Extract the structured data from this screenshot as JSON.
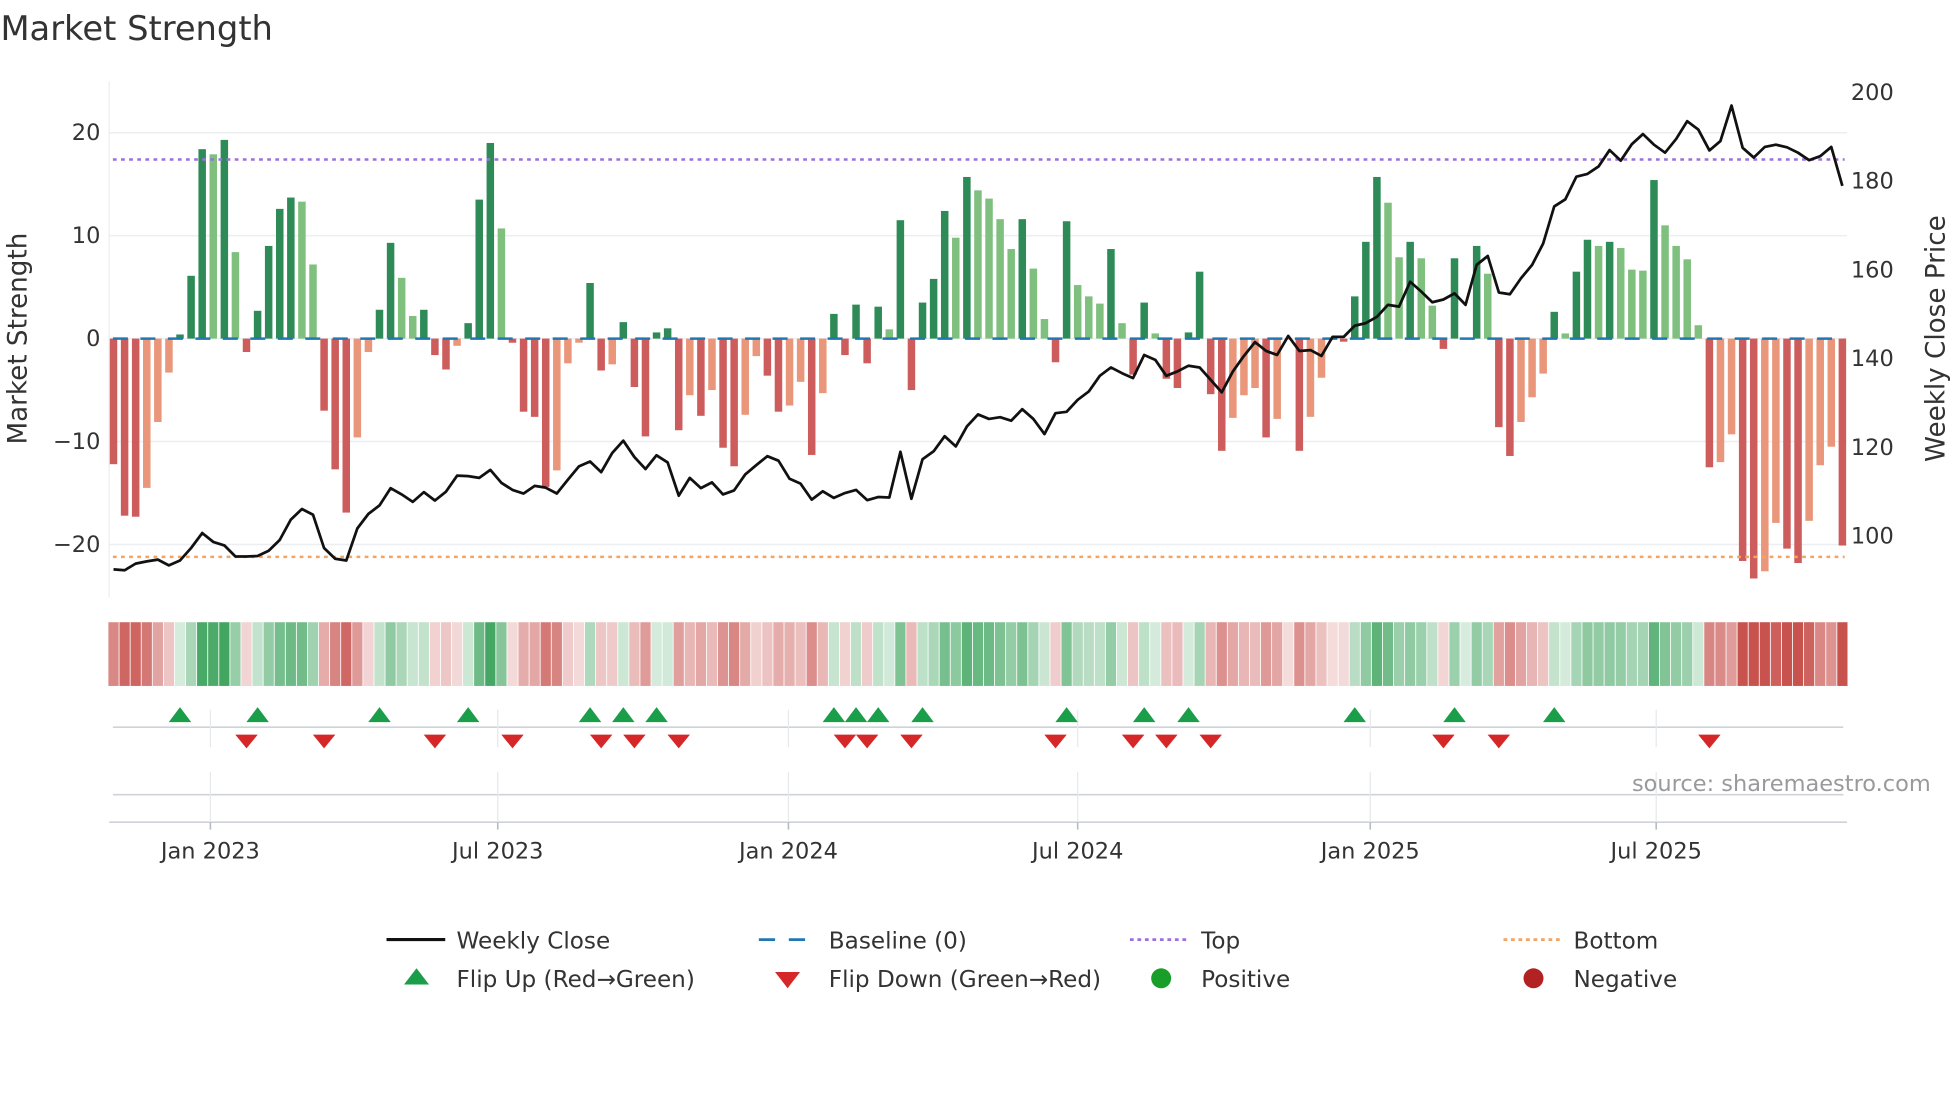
{
  "chart_data": {
    "type": "bar",
    "title": "Market Strength",
    "ylabel": "Market Strength",
    "y2label": "Weekly Close Price",
    "ylim": [
      -25,
      25
    ],
    "y2lim": [
      86.5,
      202.5
    ],
    "yticks": [
      20,
      10,
      0,
      -10,
      -20
    ],
    "ytick_labels": [
      "20",
      "10",
      "0",
      "−10",
      "−20"
    ],
    "y2ticks": [
      200,
      180,
      160,
      140,
      120,
      100
    ],
    "y2tick_labels": [
      "200",
      "180",
      "160",
      "140",
      "120",
      "100"
    ],
    "x_unit": "week index",
    "xticks": [
      {
        "x": 8.74,
        "label": "Jan 2023"
      },
      {
        "x": 34.67,
        "label": "Jul 2023"
      },
      {
        "x": 60.9,
        "label": "Jan 2024"
      },
      {
        "x": 87.0,
        "label": "Jul 2024"
      },
      {
        "x": 113.4,
        "label": "Jan 2025"
      },
      {
        "x": 139.2,
        "label": "Jul 2025"
      }
    ],
    "top_level": 17.4,
    "bottom_level": -21.2,
    "baseline": 0,
    "strength": [
      -12.2,
      -17.2,
      -17.3,
      -14.5,
      -8.1,
      -3.3,
      0.4,
      6.1,
      18.4,
      17.9,
      19.3,
      8.4,
      -1.3,
      2.7,
      9.0,
      12.6,
      13.7,
      13.3,
      7.2,
      -7.0,
      -12.7,
      -16.9,
      -9.6,
      -1.3,
      2.8,
      9.3,
      5.9,
      2.2,
      2.8,
      -1.6,
      -3.0,
      -0.7,
      1.5,
      13.5,
      19.0,
      10.7,
      -0.4,
      -7.1,
      -7.6,
      -14.4,
      -12.8,
      -2.4,
      -0.4,
      5.4,
      -3.1,
      -2.5,
      1.6,
      -4.7,
      -9.5,
      0.6,
      1.0,
      -8.9,
      -5.5,
      -7.5,
      -5.0,
      -10.6,
      -12.4,
      -7.4,
      -1.7,
      -3.6,
      -7.1,
      -6.5,
      -4.2,
      -11.3,
      -5.3,
      2.4,
      -1.6,
      3.3,
      -2.4,
      3.1,
      0.9,
      11.5,
      -5.0,
      3.5,
      5.8,
      12.4,
      9.8,
      15.7,
      14.4,
      13.6,
      11.6,
      8.7,
      11.6,
      6.8,
      1.9,
      -2.3,
      11.4,
      5.2,
      4.1,
      3.4,
      8.7,
      1.5,
      -3.5,
      3.5,
      0.5,
      -3.9,
      -4.8,
      0.6,
      6.5,
      -5.4,
      -10.9,
      -7.7,
      -5.5,
      -4.8,
      -9.6,
      -7.8,
      -0.1,
      -10.9,
      -7.6,
      -3.8,
      -0.1,
      -0.3,
      4.1,
      9.4,
      15.7,
      13.2,
      7.9,
      9.4,
      7.8,
      3.2,
      -1.0,
      7.8,
      0.1,
      9.0,
      6.3,
      -8.6,
      -11.4,
      -8.1,
      -5.7,
      -3.4,
      2.6,
      0.5,
      6.5,
      9.6,
      9.0,
      9.4,
      8.8,
      6.7,
      6.6,
      15.4,
      11.0,
      9.0,
      7.7,
      1.3,
      -12.5,
      -12.0,
      -9.3,
      -21.6,
      -23.3,
      -22.6,
      -17.9,
      -20.4,
      -21.8,
      -17.7,
      -12.3,
      -10.5,
      -20.1
    ],
    "weekly_close": [
      92.5,
      92.3,
      93.8,
      94.3,
      94.7,
      93.4,
      94.5,
      97.3,
      100.7,
      98.7,
      97.9,
      95.4,
      95.4,
      95.5,
      96.7,
      99.1,
      103.7,
      106.1,
      104.8,
      97.3,
      94.9,
      94.5,
      101.7,
      105.0,
      106.9,
      110.8,
      109.4,
      107.7,
      109.9,
      108.0,
      110.0,
      113.6,
      113.5,
      113.1,
      114.9,
      112.0,
      110.4,
      109.6,
      111.3,
      110.9,
      109.6,
      112.7,
      115.7,
      116.8,
      114.4,
      118.7,
      121.5,
      117.8,
      115.1,
      118.2,
      116.6,
      109.1,
      113.1,
      110.8,
      112.1,
      109.4,
      110.3,
      113.9,
      116.0,
      118.0,
      117.0,
      112.9,
      111.8,
      108.2,
      110.1,
      108.6,
      109.7,
      110.4,
      108.1,
      108.8,
      108.7,
      119.0,
      108.4,
      117.3,
      119.1,
      122.5,
      120.2,
      124.7,
      127.4,
      126.4,
      126.8,
      126.0,
      128.6,
      126.4,
      123.0,
      127.7,
      128.0,
      130.7,
      132.6,
      136.1,
      138.0,
      136.7,
      135.6,
      140.8,
      139.7,
      136.1,
      137.1,
      138.4,
      138.0,
      135.2,
      132.4,
      137.1,
      140.6,
      143.7,
      141.7,
      140.8,
      145.1,
      141.7,
      141.9,
      140.6,
      144.9,
      144.9,
      147.4,
      148.0,
      149.4,
      152.1,
      151.7,
      157.3,
      155.1,
      152.7,
      153.3,
      154.7,
      152.1,
      161.1,
      163.1,
      154.9,
      154.5,
      158.1,
      161.1,
      165.9,
      174.3,
      175.9,
      181.0,
      181.6,
      183.3,
      187.0,
      184.6,
      188.3,
      190.6,
      188.2,
      186.4,
      189.5,
      193.5,
      191.6,
      186.9,
      189.0,
      197.0,
      187.5,
      185.3,
      187.7,
      188.2,
      187.6,
      186.4,
      184.7,
      185.6,
      187.7,
      178.9
    ],
    "flip_up_weeks": [
      7,
      14,
      25,
      33,
      44,
      47,
      50,
      66,
      68,
      70,
      74,
      87,
      94,
      98,
      113,
      122,
      131
    ],
    "flip_down_weeks": [
      13,
      20,
      30,
      37,
      45,
      48,
      52,
      67,
      69,
      73,
      86,
      93,
      96,
      100,
      121,
      126,
      145
    ],
    "legend": {
      "placement": "bottom",
      "items": [
        {
          "key": "close",
          "label": "Weekly Close"
        },
        {
          "key": "baseline",
          "label": "Baseline (0)"
        },
        {
          "key": "top",
          "label": "Top"
        },
        {
          "key": "bottom",
          "label": "Bottom"
        },
        {
          "key": "flip_up",
          "label": "Flip Up (Red→Green)"
        },
        {
          "key": "flip_down",
          "label": "Flip Down (Green→Red)"
        },
        {
          "key": "positive",
          "label": "Positive"
        },
        {
          "key": "negative",
          "label": "Negative"
        }
      ]
    },
    "source": "source: sharemaestro.com",
    "colors": {
      "pos_strong": "#2e8b57",
      "pos_weak": "#7fc07f",
      "neg_strong": "#cd5c5c",
      "neg_weak": "#e9967a",
      "strip_pos": "#3da35d",
      "strip_neg": "#c8524e",
      "close": "#111111",
      "baseline": "#1f77b4",
      "top": "#9b6fe0",
      "bottom": "#f4a460",
      "flip_up": "#1a9e4a",
      "flip_down": "#d62728",
      "positive": "#1a9e2a",
      "negative": "#b22222"
    }
  }
}
